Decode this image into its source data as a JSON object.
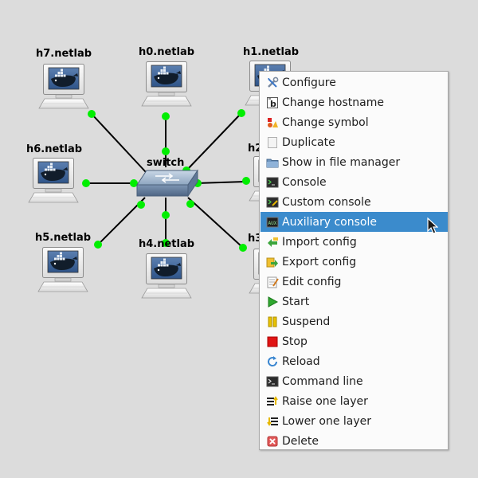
{
  "topology": {
    "nodes": [
      {
        "id": "h7",
        "label": "h7.netlab",
        "type": "docker-host"
      },
      {
        "id": "h0",
        "label": "h0.netlab",
        "type": "docker-host"
      },
      {
        "id": "h1",
        "label": "h1.netlab",
        "type": "docker-host"
      },
      {
        "id": "h6",
        "label": "h6.netlab",
        "type": "docker-host"
      },
      {
        "id": "h2",
        "label": "h2",
        "type": "docker-host"
      },
      {
        "id": "h5",
        "label": "h5.netlab",
        "type": "docker-host"
      },
      {
        "id": "h4",
        "label": "h4.netlab",
        "type": "docker-host"
      },
      {
        "id": "h3",
        "label": "h3",
        "type": "docker-host"
      },
      {
        "id": "switch",
        "label": "switch",
        "type": "ethernet-switch"
      }
    ],
    "port_color": "#00ee00"
  },
  "context_menu": {
    "highlight_color": "#3b8bcc",
    "items": [
      {
        "label": "Configure",
        "icon": "wrench-screwdriver-icon"
      },
      {
        "label": "Change hostname",
        "icon": "rename-b-icon"
      },
      {
        "label": "Change symbol",
        "icon": "symbol-shapes-icon"
      },
      {
        "label": "Duplicate",
        "icon": "duplicate-page-icon"
      },
      {
        "label": "Show in file manager",
        "icon": "folder-icon"
      },
      {
        "label": "Console",
        "icon": "terminal-icon"
      },
      {
        "label": "Custom console",
        "icon": "terminal-edit-icon"
      },
      {
        "label": "Auxiliary console",
        "icon": "aux-terminal-icon",
        "highlighted": true
      },
      {
        "label": "Import config",
        "icon": "import-icon"
      },
      {
        "label": "Export config",
        "icon": "export-icon"
      },
      {
        "label": "Edit config",
        "icon": "edit-notepad-icon"
      },
      {
        "label": "Start",
        "icon": "play-icon"
      },
      {
        "label": "Suspend",
        "icon": "pause-icon"
      },
      {
        "label": "Stop",
        "icon": "stop-icon"
      },
      {
        "label": "Reload",
        "icon": "reload-icon"
      },
      {
        "label": "Command line",
        "icon": "command-line-icon"
      },
      {
        "label": "Raise one layer",
        "icon": "raise-layer-icon"
      },
      {
        "label": "Lower one layer",
        "icon": "lower-layer-icon"
      },
      {
        "label": "Delete",
        "icon": "delete-icon"
      }
    ]
  }
}
